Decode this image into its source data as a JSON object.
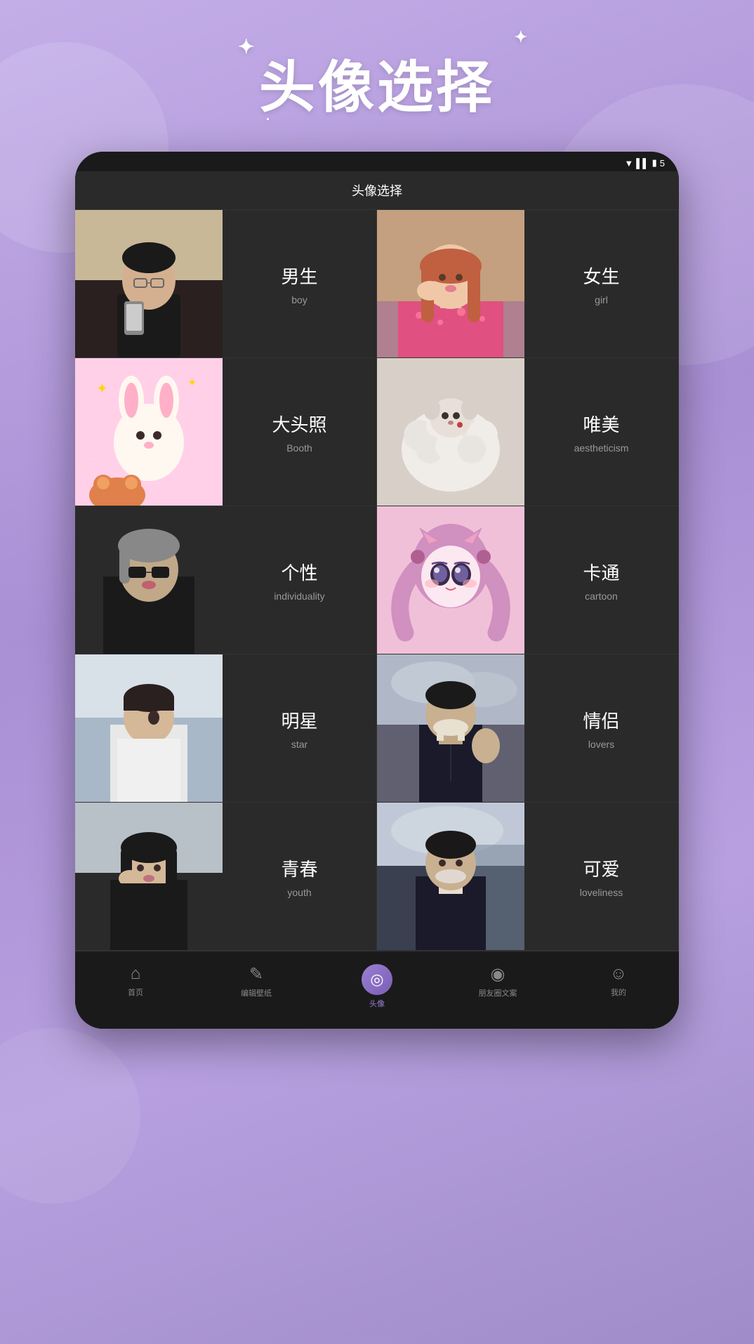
{
  "header": {
    "title": "头像选择",
    "sparkles": [
      "✦",
      "✦",
      "·"
    ]
  },
  "topBar": {
    "title": "头像选择"
  },
  "statusBar": {
    "wifi": "▼",
    "signal": "▌▌▌",
    "battery": "█",
    "time": "5"
  },
  "grid": [
    {
      "row": 0,
      "cells": [
        {
          "type": "image",
          "id": "boy-img",
          "bg": "boy"
        },
        {
          "type": "text",
          "cn": "男生",
          "en": "boy",
          "id": "boy"
        },
        {
          "type": "image",
          "id": "girl-img",
          "bg": "girl"
        },
        {
          "type": "text",
          "cn": "女生",
          "en": "girl",
          "id": "girl"
        }
      ]
    },
    {
      "row": 1,
      "cells": [
        {
          "type": "image",
          "id": "booth-img",
          "bg": "booth"
        },
        {
          "type": "text",
          "cn": "大头照",
          "en": "Booth",
          "id": "booth"
        },
        {
          "type": "image",
          "id": "aestheticism-img",
          "bg": "aestheticism"
        },
        {
          "type": "text",
          "cn": "唯美",
          "en": "aestheticism",
          "id": "aestheticism"
        }
      ]
    },
    {
      "row": 2,
      "cells": [
        {
          "type": "image",
          "id": "individuality-img",
          "bg": "individuality"
        },
        {
          "type": "text",
          "cn": "个性",
          "en": "individuality",
          "id": "individuality"
        },
        {
          "type": "image",
          "id": "cartoon-img",
          "bg": "cartoon"
        },
        {
          "type": "text",
          "cn": "卡通",
          "en": "cartoon",
          "id": "cartoon"
        }
      ]
    },
    {
      "row": 3,
      "cells": [
        {
          "type": "image",
          "id": "star-img",
          "bg": "star"
        },
        {
          "type": "text",
          "cn": "明星",
          "en": "star",
          "id": "star"
        },
        {
          "type": "image",
          "id": "lovers-img",
          "bg": "lovers"
        },
        {
          "type": "text",
          "cn": "情侣",
          "en": "lovers",
          "id": "lovers"
        }
      ]
    },
    {
      "row": 4,
      "cells": [
        {
          "type": "image",
          "id": "youth-img",
          "bg": "youth"
        },
        {
          "type": "text",
          "cn": "青春",
          "en": "youth",
          "id": "youth"
        },
        {
          "type": "image",
          "id": "loveliness-img",
          "bg": "loveliness"
        },
        {
          "type": "text",
          "cn": "可爱",
          "en": "loveliness",
          "id": "loveliness"
        }
      ]
    }
  ],
  "bottomNav": [
    {
      "id": "home",
      "icon": "⌂",
      "label": "首页",
      "active": false
    },
    {
      "id": "wallpaper",
      "icon": "✎",
      "label": "编辑壁纸",
      "active": false
    },
    {
      "id": "avatar",
      "icon": "◎",
      "label": "头像",
      "active": true
    },
    {
      "id": "moments",
      "icon": "◉",
      "label": "朋友圈文案",
      "active": false
    },
    {
      "id": "mine",
      "icon": "☺",
      "label": "我的",
      "active": false
    }
  ]
}
